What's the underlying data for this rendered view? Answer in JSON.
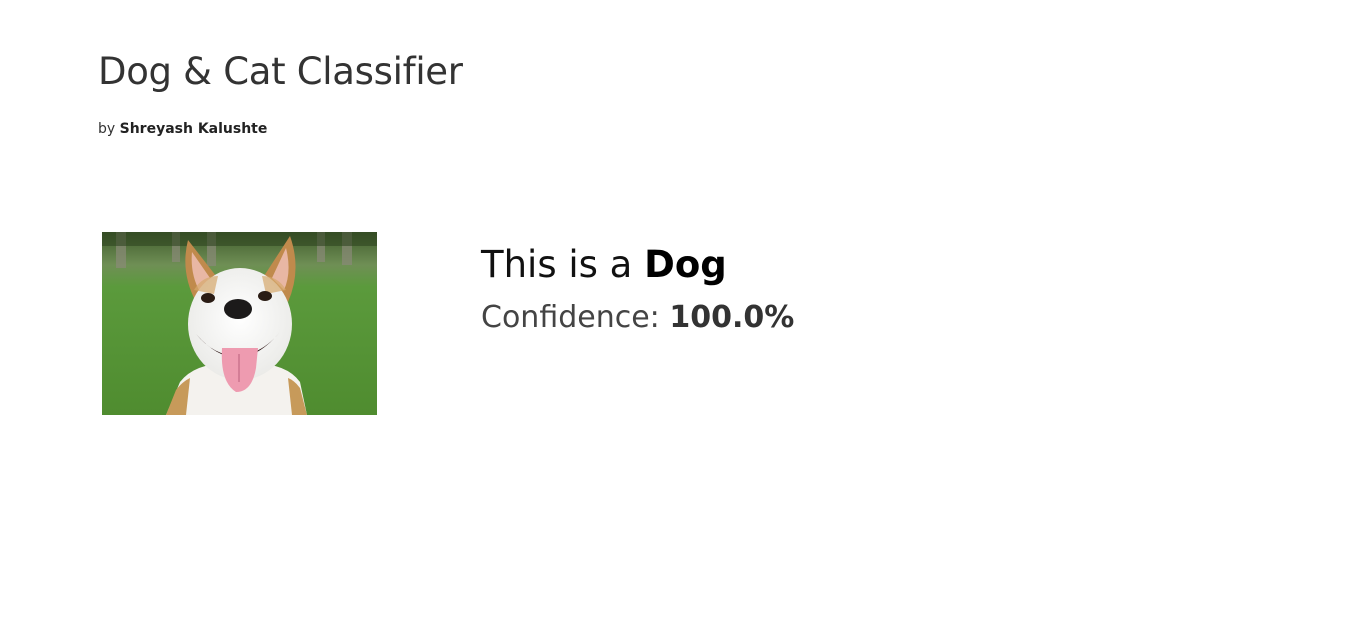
{
  "header": {
    "title": "Dog & Cat Classifier",
    "by_prefix": "by ",
    "author": "Shreyash Kalushte"
  },
  "image": {
    "subject": "smiling white and tan dog on grass"
  },
  "result": {
    "prefix": "This is a ",
    "label": "Dog",
    "confidence_prefix": "Confidence: ",
    "confidence_value": "100.0%"
  },
  "colors": {
    "text": "#333333",
    "grass": "#5a9a3a",
    "background": "#ffffff"
  }
}
